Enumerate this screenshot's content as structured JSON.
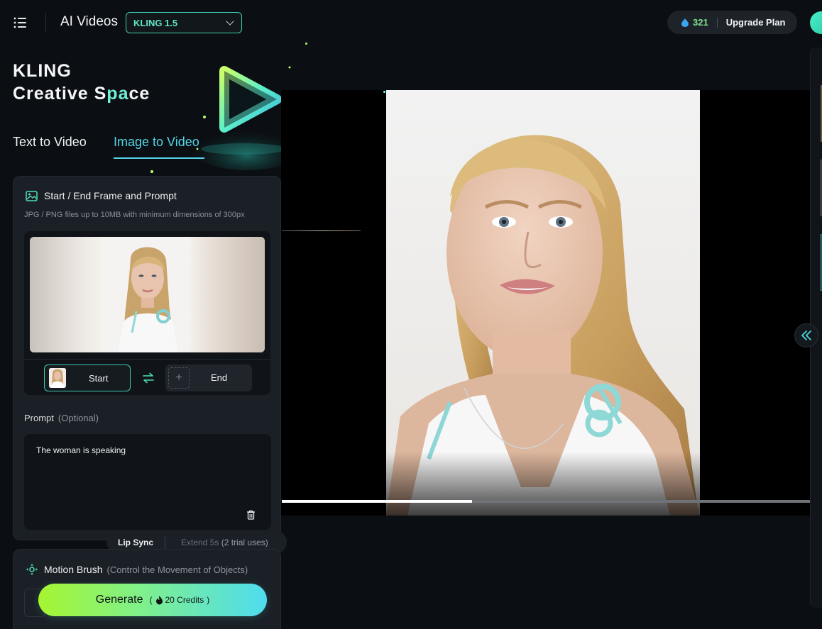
{
  "header": {
    "title": "AI Videos",
    "model_selected": "KLING 1.5",
    "credits": "321",
    "upgrade_label": "Upgrade Plan"
  },
  "hero": {
    "line1": "KLING",
    "line2_prefix": "Creative S",
    "line2_accent": "pa",
    "line2_suffix": "ce"
  },
  "tabs": [
    {
      "label": "Text to Video",
      "active": false
    },
    {
      "label": "Image to Video",
      "active": true
    }
  ],
  "frame_card": {
    "title": "Start / End Frame and Prompt",
    "hint": "JPG / PNG files up to 10MB with minimum dimensions of 300px",
    "start_label": "Start",
    "end_label": "End"
  },
  "prompt": {
    "label": "Prompt",
    "optional": "(Optional)",
    "value": "The woman is speaking"
  },
  "actions_bar": {
    "lip_sync": "Lip Sync",
    "extend": "Extend 5s",
    "extend_note": "(2 trial uses)"
  },
  "motion_brush": {
    "title": "Motion Brush",
    "subtitle": "(Control the Movement of Objects)"
  },
  "generate": {
    "label": "Generate",
    "credits_open": "(",
    "credits_text": "20 Credits",
    "credits_close": ")"
  },
  "video": {
    "progress": 0.36
  },
  "colors": {
    "accent_teal": "#3dcfb0",
    "accent_cyan": "#54d5e8",
    "credit_green": "#7ee08c"
  },
  "icons": [
    "menu-icon",
    "chevron-down-icon",
    "drop-icon",
    "image-icon",
    "swap-icon",
    "plus-icon",
    "trash-icon",
    "motion-brush-icon",
    "fire-icon",
    "double-chevron-left-icon"
  ]
}
